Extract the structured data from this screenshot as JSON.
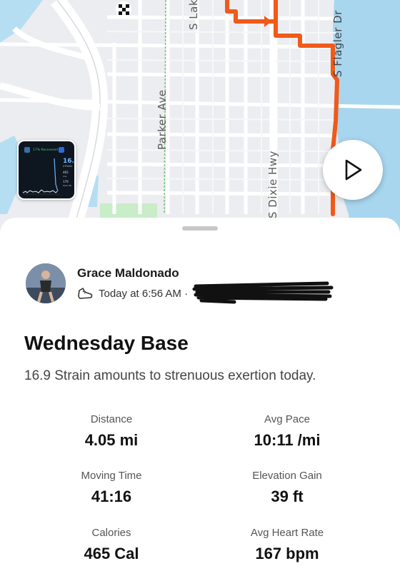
{
  "map": {
    "streets": {
      "parker": "Parker Ave",
      "lake": "S Lake",
      "dixie": "S Dixie Hwy",
      "flagler": "S Flagler Dr"
    },
    "route_color": "#f05a1a",
    "water_color": "#a8d6ef",
    "park_color": "#c9ecc9",
    "thumbnail": {
      "badge": "17% Recovered",
      "strain": "16.",
      "lines": [
        "STRAIN",
        "465",
        "CAL",
        "179",
        "MAX HR"
      ]
    }
  },
  "activity": {
    "user_name": "Grace Maldonado",
    "timestamp": "Today at 6:56 AM ·",
    "title": "Wednesday Base",
    "description": "16.9 Strain amounts to strenuous exertion today.",
    "stats": [
      {
        "label": "Distance",
        "value": "4.05 mi"
      },
      {
        "label": "Avg Pace",
        "value": "10:11 /mi"
      },
      {
        "label": "Moving Time",
        "value": "41:16"
      },
      {
        "label": "Elevation Gain",
        "value": "39 ft"
      },
      {
        "label": "Calories",
        "value": "465 Cal"
      },
      {
        "label": "Avg Heart Rate",
        "value": "167 bpm"
      }
    ]
  }
}
